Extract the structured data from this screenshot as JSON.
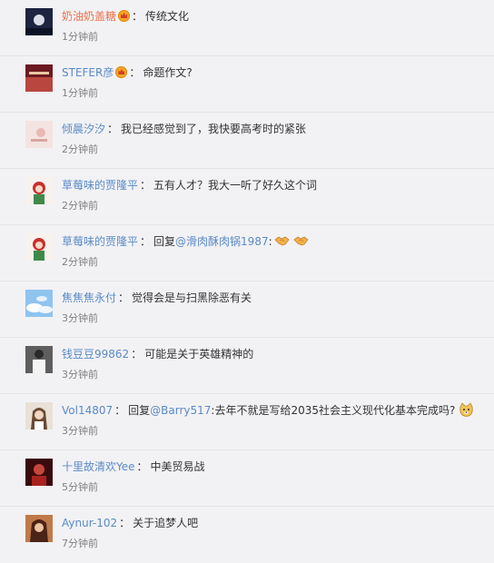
{
  "comments": [
    {
      "user": "奶油奶盖糖",
      "user_color": "#eb7350",
      "has_badge": true,
      "sep": "：",
      "text": "传统文化",
      "time": "1分钟前"
    },
    {
      "user": "STEFER彦",
      "user_color": "#5a8ac6",
      "has_badge": true,
      "sep": "：",
      "text": "命题作文?",
      "time": "1分钟前"
    },
    {
      "user": "倾晨汐汐",
      "user_color": "#5a8ac6",
      "sep": "：",
      "text": "我已经感觉到了，我快要高考时的紧张",
      "time": "2分钟前"
    },
    {
      "user": "草莓味的贾隆平",
      "user_color": "#5a8ac6",
      "sep": "：",
      "text": "五有人才？我大一听了好久这个词",
      "time": "2分钟前"
    },
    {
      "user": "草莓味的贾隆平",
      "user_color": "#5a8ac6",
      "sep": "：",
      "reply_prefix": "回复",
      "mention": "@滑肉酥肉锅1987",
      "text": ":",
      "emoji_icons": [
        "handshake-icon",
        "handshake-icon"
      ],
      "time": "2分钟前"
    },
    {
      "user": "焦焦焦永付",
      "user_color": "#5a8ac6",
      "sep": "：",
      "text": "觉得会是与扫黑除恶有关",
      "time": "3分钟前"
    },
    {
      "user": "钱豆豆99862",
      "user_color": "#5a8ac6",
      "sep": "：",
      "text": "可能是关于英雄精神的",
      "time": "3分钟前"
    },
    {
      "user": "Vol14807",
      "user_color": "#5a8ac6",
      "sep": "：",
      "reply_prefix": "回复",
      "mention": "@Barry517",
      "text": ":去年不就是写给2035社会主义现代化基本完成吗?",
      "emoji_icons": [
        "doge-icon"
      ],
      "time": "3分钟前"
    },
    {
      "user": "十里故清欢Yee",
      "user_color": "#5a8ac6",
      "sep": "：",
      "text": "中美贸易战",
      "time": "5分钟前"
    },
    {
      "user": "Aynur-102",
      "user_color": "#5a8ac6",
      "sep": "：",
      "text": "关于追梦人吧",
      "time": "7分钟前"
    }
  ],
  "colors": {
    "username": "#5a8ac6",
    "username_vip": "#eb7350",
    "time": "#808080",
    "background": "#f2f2f5",
    "divider": "#e3e3e3"
  }
}
